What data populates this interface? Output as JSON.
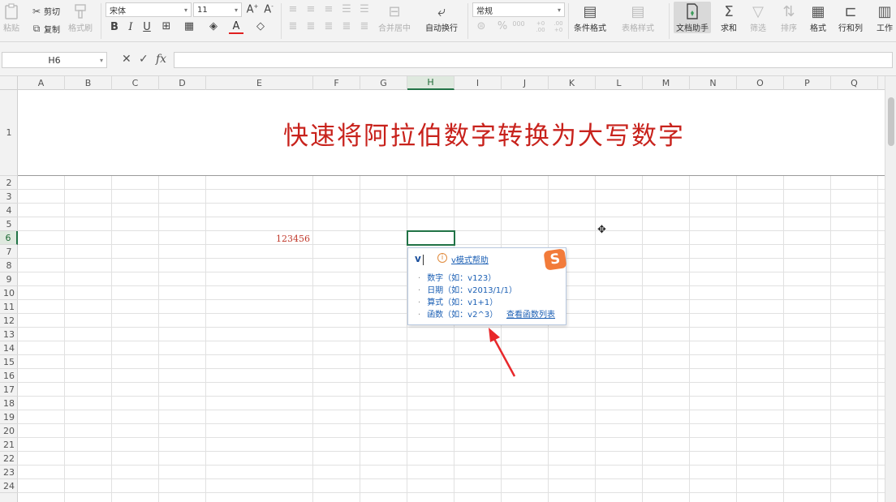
{
  "ribbon": {
    "paste": "粘贴",
    "cut": "剪切",
    "copy": "复制",
    "format_painter": "格式刷",
    "font_name": "宋体",
    "font_size": "11",
    "bold": "B",
    "italic": "I",
    "underline": "U",
    "merge_center": "合并居中",
    "wrap_text": "自动换行",
    "number_format": "常规",
    "percent": "%",
    "thousands": "000",
    "inc_decimal": "+0 .00",
    "dec_decimal": ".00 +0",
    "conditional_format": "条件格式",
    "table_style": "表格样式",
    "doc_assistant": "文档助手",
    "sum": "求和",
    "filter": "筛选",
    "sort": "排序",
    "format": "格式",
    "rows_cols": "行和列",
    "worksheet": "工作"
  },
  "formula_bar": {
    "name_box": "H6",
    "fx": "fx",
    "value": ""
  },
  "sheet": {
    "columns": [
      "A",
      "B",
      "C",
      "D",
      "E",
      "F",
      "G",
      "H",
      "I",
      "J",
      "K",
      "L",
      "M",
      "N",
      "O",
      "P",
      "Q"
    ],
    "rows": [
      "1",
      "2",
      "3",
      "4",
      "5",
      "6",
      "7",
      "8",
      "9",
      "10",
      "11",
      "12",
      "13",
      "14",
      "15",
      "16",
      "17",
      "18",
      "19",
      "20",
      "21",
      "22",
      "23",
      "24"
    ],
    "selected_cell": "H6",
    "title": "快速将阿拉伯数字转换为大写数字",
    "e6_value": "123456"
  },
  "ime_popup": {
    "input": "v",
    "help_link": "v模式帮助",
    "logo": "S",
    "items": [
      "数字（如：v123）",
      "日期（如：v2013/1/1）",
      "算式（如：v1+1）",
      "函数（如：v2^3）"
    ],
    "func_list_link": "查看函数列表"
  },
  "colors": {
    "title_red": "#c8221c",
    "selection_green": "#217346",
    "annotation_arrow": "#e8282b"
  }
}
